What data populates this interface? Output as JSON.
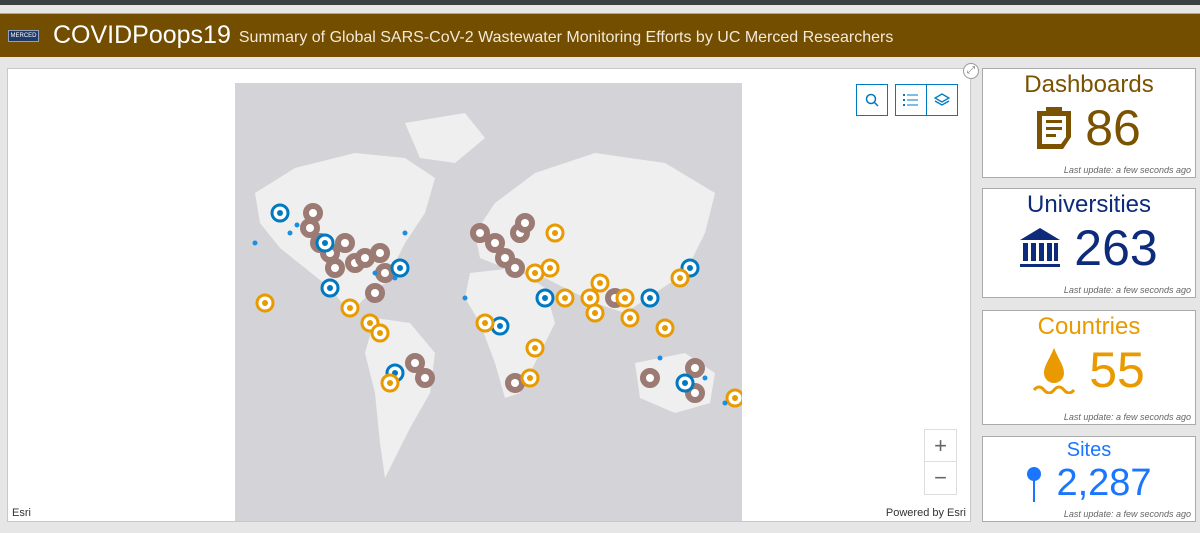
{
  "header": {
    "logo_text": "MERCED",
    "title": "COVIDPoops19",
    "subtitle": "Summary of Global SARS-CoV-2 Wastewater Monitoring Efforts by UC Merced Researchers"
  },
  "map": {
    "attribution": "Esri",
    "powered_by": "Powered by Esri",
    "zoom_in": "+",
    "zoom_out": "−",
    "icons": [
      "search-icon",
      "legend-icon",
      "layers-icon",
      "expand-icon"
    ]
  },
  "cards": [
    {
      "title": "Dashboards",
      "value": "86",
      "icon": "clipboard-icon",
      "color": "#7a5200",
      "update": "Last update: a few seconds ago"
    },
    {
      "title": "Universities",
      "value": "263",
      "icon": "university-icon",
      "color": "#0d2b7a",
      "update": "Last update: a few seconds ago"
    },
    {
      "title": "Countries",
      "value": "55",
      "icon": "water-drop-icon",
      "color": "#e89a00",
      "update": "Last update: a few seconds ago"
    },
    {
      "title": "Sites",
      "value": "2,287",
      "icon": "pin-icon",
      "color": "#1a75ff",
      "update": "Last update: a few seconds ago"
    }
  ],
  "colors": {
    "header": "#734d00",
    "dashboard_marker": "#9b7b73",
    "university_marker": "#0079c1",
    "country_marker": "#e89a00",
    "site_marker": "#1a8fe0"
  }
}
